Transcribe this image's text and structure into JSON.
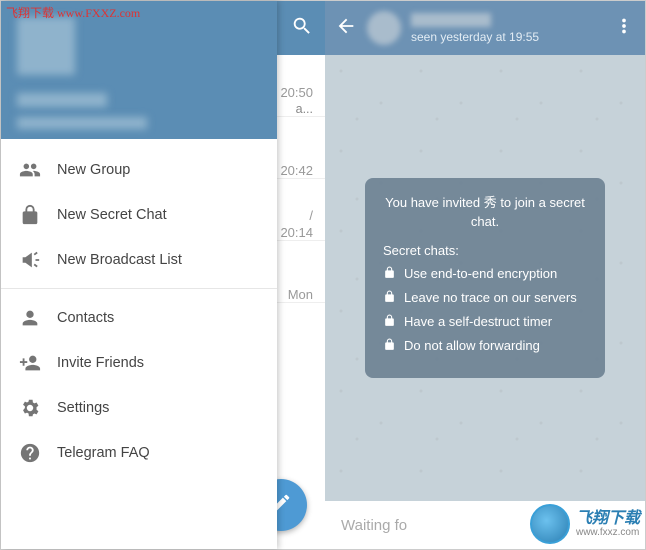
{
  "watermark": {
    "top_text": "飞翔下载",
    "top_url": "www.FXXZ.com",
    "bottom_text": "飞翔下载",
    "bottom_url": "www.fxxz.com"
  },
  "drawer": {
    "menu": [
      {
        "label": "New Group",
        "icon": "group-icon"
      },
      {
        "label": "New Secret Chat",
        "icon": "lock-icon"
      },
      {
        "label": "New Broadcast List",
        "icon": "megaphone-icon"
      }
    ],
    "menu2": [
      {
        "label": "Contacts",
        "icon": "person-icon"
      },
      {
        "label": "Invite Friends",
        "icon": "person-add-icon"
      },
      {
        "label": "Settings",
        "icon": "gear-icon"
      },
      {
        "label": "Telegram FAQ",
        "icon": "help-icon"
      }
    ]
  },
  "chatlist": {
    "rows": [
      {
        "time": "20:50",
        "preview": "a..."
      },
      {
        "time": "20:42",
        "preview": ""
      },
      {
        "time": "20:14",
        "preview": ""
      },
      {
        "time": "Mon",
        "preview": ""
      }
    ]
  },
  "chat": {
    "status": "seen yesterday at 19:55",
    "card": {
      "title_pre": "You have invited ",
      "title_name": "秀",
      "title_post": " to join a secret chat.",
      "subhead": "Secret chats:",
      "features": [
        "Use end-to-end encryption",
        "Leave no trace on our servers",
        "Have a self-destruct timer",
        "Do not allow forwarding"
      ]
    },
    "input_placeholder": "Waiting fo"
  }
}
